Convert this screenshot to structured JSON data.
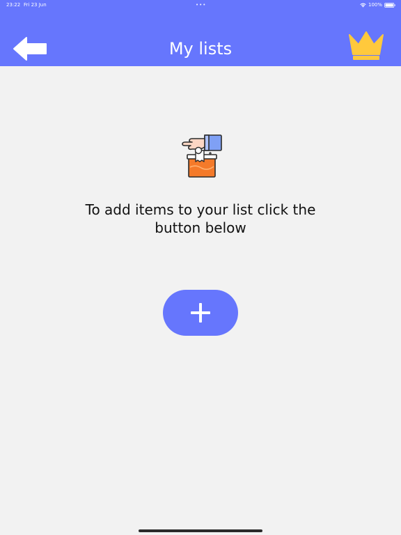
{
  "status_bar": {
    "time": "23:22",
    "date": "Fri 23 Jun",
    "dots": "•••",
    "battery": "100%"
  },
  "header": {
    "title": "My lists",
    "back_icon": "arrow-left-icon",
    "premium_icon": "crown-icon"
  },
  "empty_state": {
    "illustration": "hand-dropping-into-box",
    "message": "To add items to your list click the button below"
  },
  "add_button": {
    "icon": "plus-icon"
  },
  "colors": {
    "accent": "#6676fd",
    "background": "#f2f2f2",
    "crown": "#ffc93c",
    "box": "#f47a2a"
  }
}
